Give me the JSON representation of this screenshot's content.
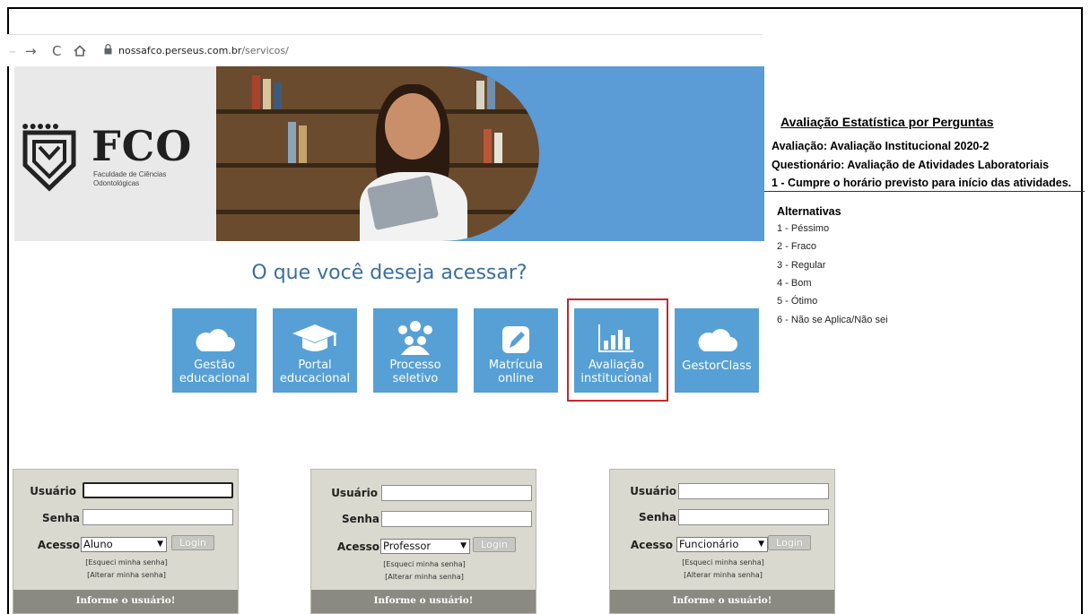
{
  "browser": {
    "back_icon": "arrow-left-icon",
    "forward_icon": "arrow-right-icon",
    "reload_icon": "reload-icon",
    "home_icon": "home-icon",
    "url_host": "nossafco.perseus.com.br",
    "url_path": "/servicos/"
  },
  "brand": {
    "name": "FCO",
    "subtitle_line1": "Faculdade de Ciências",
    "subtitle_line2": "Odontológicas"
  },
  "main": {
    "question": "O que você deseja acessar?",
    "tiles": [
      {
        "line1": "Gestão",
        "line2": "educacional",
        "icon": "cloud-icon"
      },
      {
        "line1": "Portal",
        "line2": "educacional",
        "icon": "graduation-cap-icon"
      },
      {
        "line1": "Processo",
        "line2": "seletivo",
        "icon": "people-icon"
      },
      {
        "line1": "Matrícula",
        "line2": "online",
        "icon": "pencil-icon"
      },
      {
        "line1": "Avaliação",
        "line2": "institucional",
        "icon": "bar-chart-icon"
      },
      {
        "line1": "GestorClass",
        "line2": "",
        "icon": "cloud-icon"
      }
    ],
    "highlight_color": "#c8262c",
    "tile_color": "#56a0d6"
  },
  "panel": {
    "title": "Avaliação Estatística por Perguntas",
    "avaliacao": "Avaliação: Avaliação Institucional 2020-2",
    "questionario": "Questionário: Avaliação de Atividades Laboratoriais",
    "pergunta": "1 - Cumpre o horário previsto para início das atividades.",
    "alternativas_title": "Alternativas",
    "alternativas": [
      "1 - Péssimo",
      "2 - Fraco",
      "3 - Regular",
      "4 - Bom",
      "5 - Ótimo",
      "6 - Não se Aplica/Não sei"
    ]
  },
  "logins": [
    {
      "usuario_label": "Usuário",
      "senha_label": "Senha",
      "acesso_label": "Acesso",
      "acesso_value": "Aluno",
      "login_button": "Login",
      "forgot": "[Esqueci minha senha]",
      "change": "[Alterar minha senha]",
      "status": "Informe o usuário!"
    },
    {
      "usuario_label": "Usuário",
      "senha_label": "Senha",
      "acesso_label": "Acesso",
      "acesso_value": "Professor",
      "login_button": "Login",
      "forgot": "[Esqueci minha senha]",
      "change": "[Alterar minha senha]",
      "status": "Informe o usuário!"
    },
    {
      "usuario_label": "Usuário",
      "senha_label": "Senha",
      "acesso_label": "Acesso",
      "acesso_value": "Funcionário",
      "login_button": "Login",
      "forgot": "[Esqueci minha senha]",
      "change": "[Alterar minha senha]",
      "status": "Informe o usuário!"
    }
  ]
}
